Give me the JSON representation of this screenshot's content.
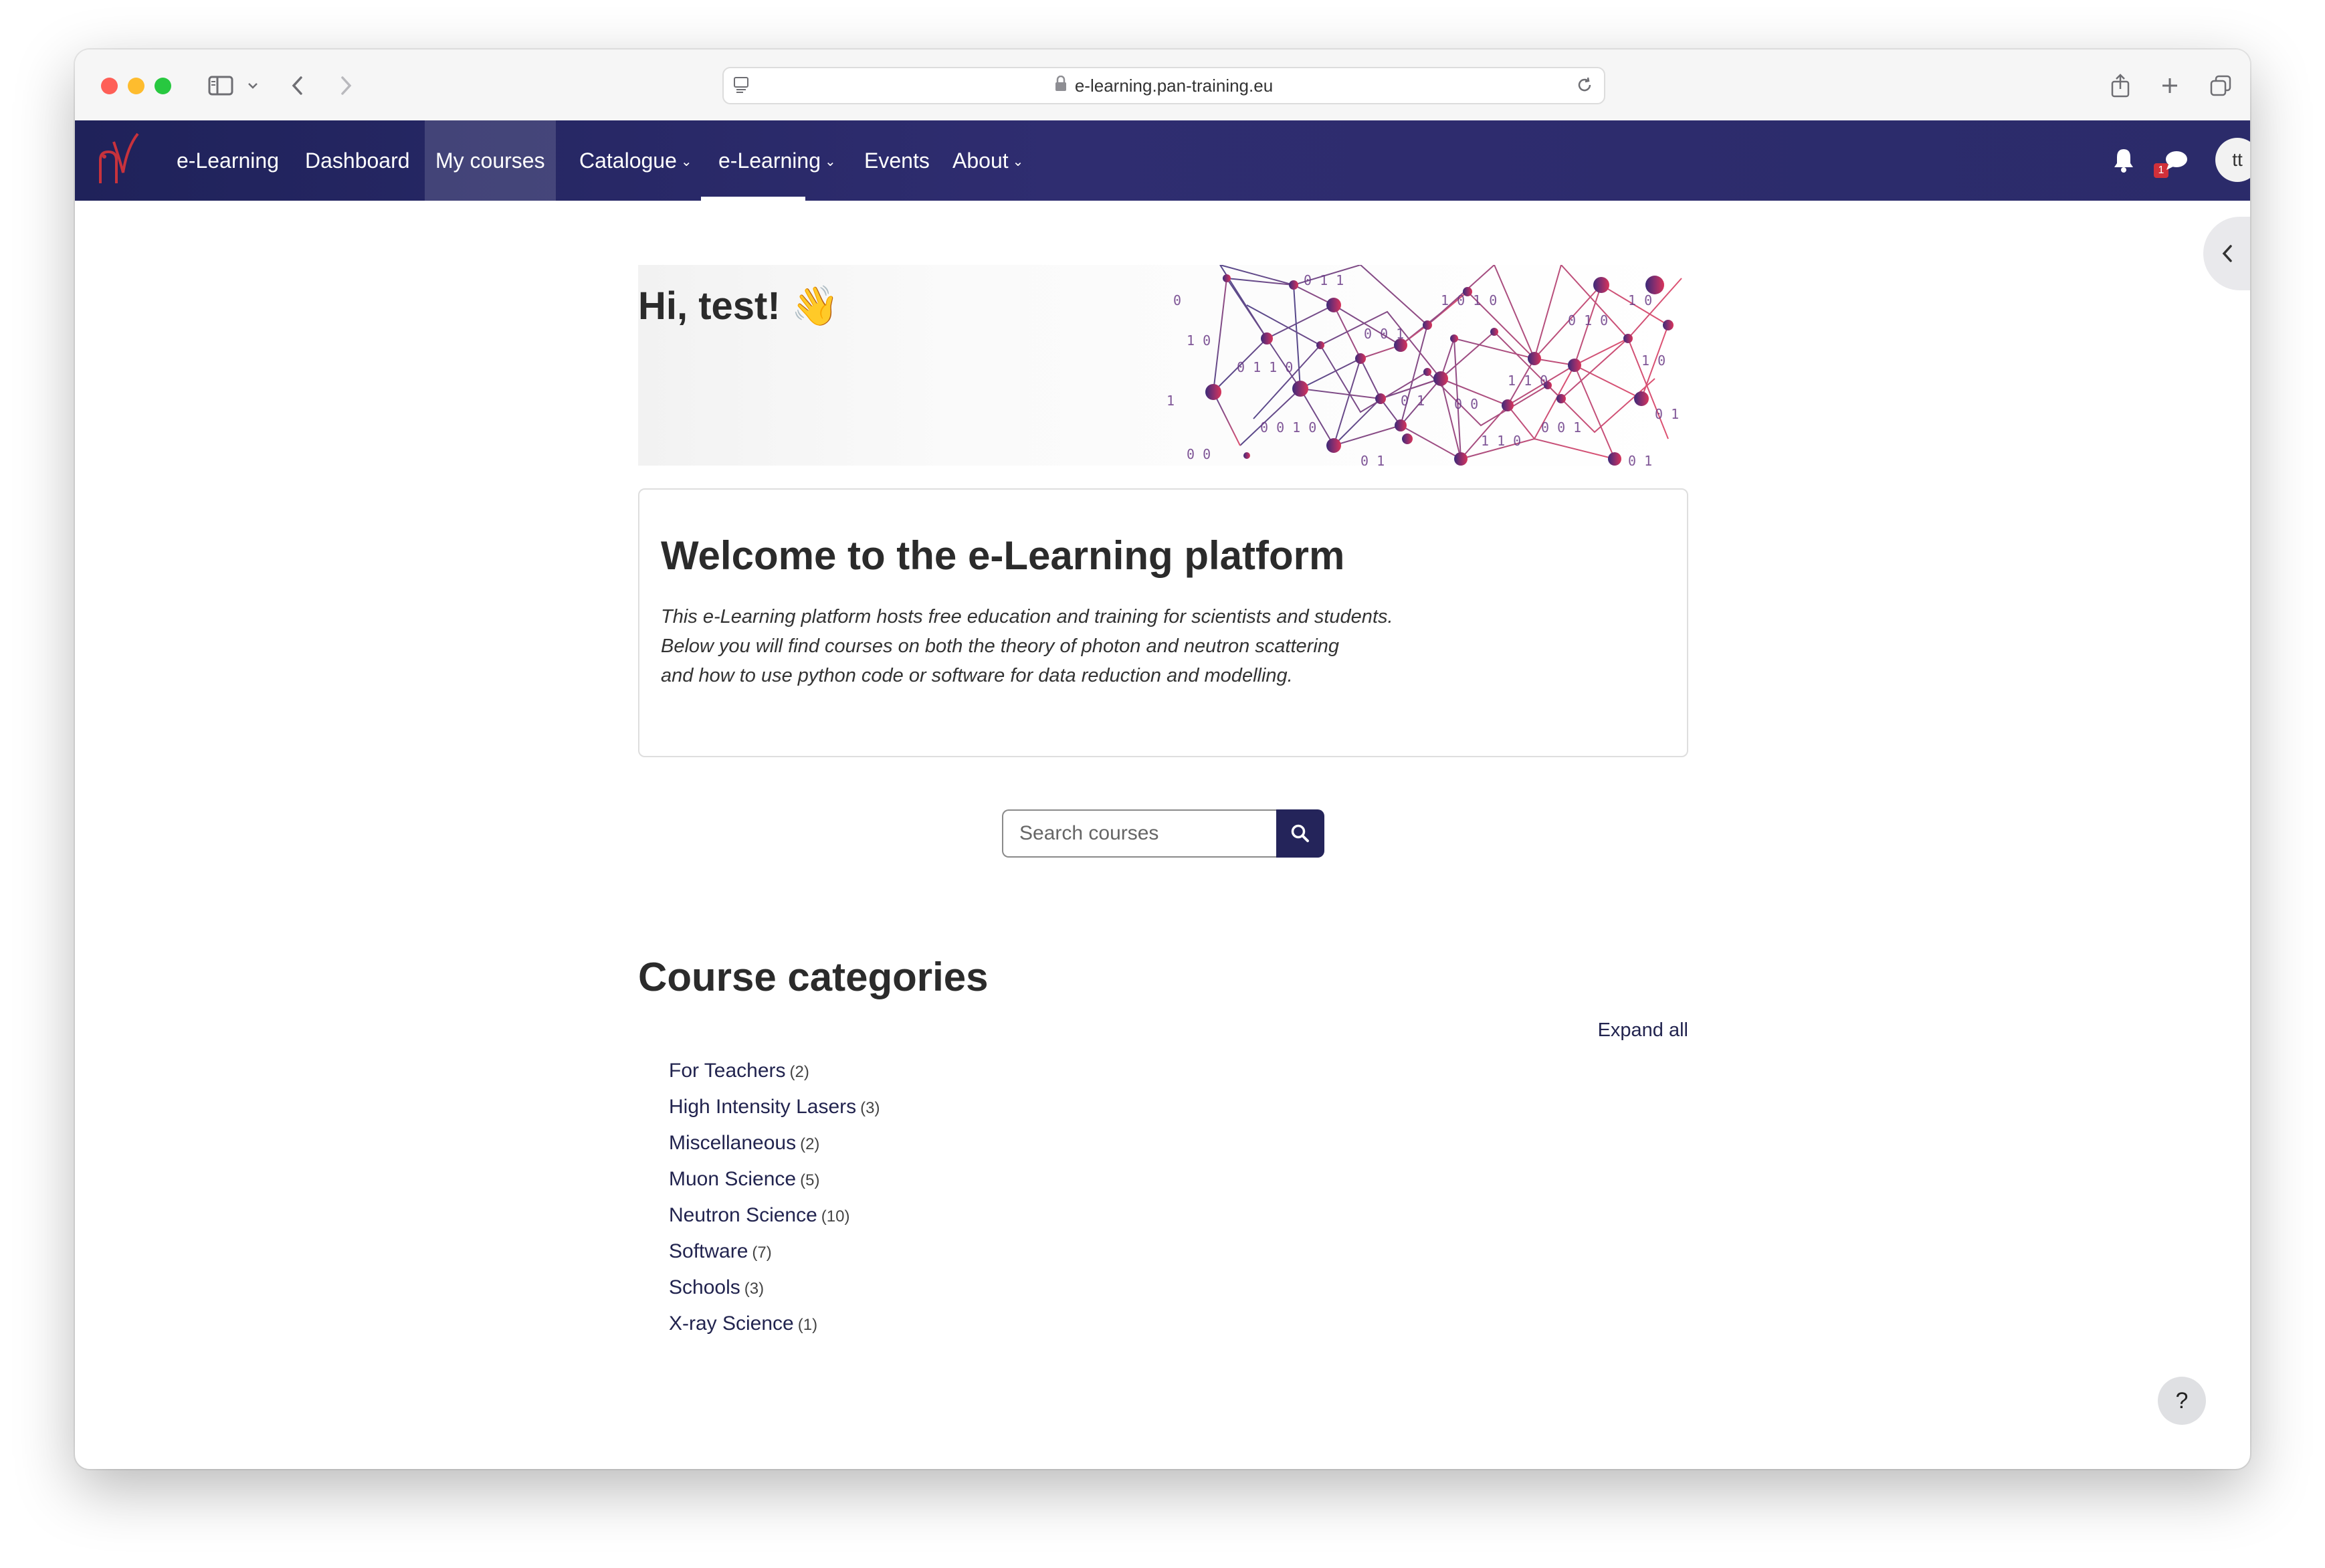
{
  "browser": {
    "url": "e-learning.pan-training.eu"
  },
  "navbar": {
    "items": [
      {
        "label": "e-Learning"
      },
      {
        "label": "Dashboard"
      },
      {
        "label": "My courses"
      },
      {
        "label": "Catalogue"
      },
      {
        "label": "e-Learning"
      },
      {
        "label": "Events"
      },
      {
        "label": "About"
      }
    ],
    "notifications_count": "1",
    "user_initials": "tt"
  },
  "hero": {
    "greeting": "Hi, test! 👋"
  },
  "welcome": {
    "title": "Welcome to the e-Learning platform",
    "lines": [
      "This e-Learning platform hosts free education and training for scientists and students.",
      "Below you will find courses on both the theory of photon and neutron scattering",
      "and how to use python code or software for data reduction and modelling."
    ]
  },
  "search": {
    "placeholder": "Search courses"
  },
  "categories": {
    "title": "Course categories",
    "expand_all": "Expand all",
    "items": [
      {
        "name": "For Teachers",
        "count": "(2)"
      },
      {
        "name": "High Intensity Lasers",
        "count": "(3)"
      },
      {
        "name": "Miscellaneous",
        "count": "(2)"
      },
      {
        "name": "Muon Science",
        "count": "(5)"
      },
      {
        "name": "Neutron Science",
        "count": "(10)"
      },
      {
        "name": "Software",
        "count": "(7)"
      },
      {
        "name": "Schools",
        "count": "(3)"
      },
      {
        "name": "X-ray Science",
        "count": "(1)"
      }
    ]
  },
  "help": {
    "label": "?"
  }
}
